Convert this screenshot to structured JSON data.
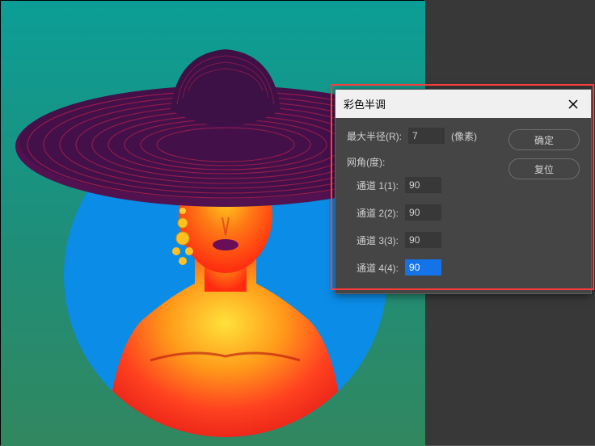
{
  "dialog": {
    "title": "彩色半调",
    "max_radius_label": "最大半径(R):",
    "max_radius_value": "7",
    "pixel_unit": "(像素)",
    "screen_angle_label": "网角(度):",
    "channel1_label": "通道 1(1):",
    "channel1_value": "90",
    "channel2_label": "通道 2(2):",
    "channel2_value": "90",
    "channel3_label": "通道 3(3):",
    "channel3_value": "90",
    "channel4_label": "通道 4(4):",
    "channel4_value": "90",
    "ok_label": "确定",
    "reset_label": "复位"
  }
}
